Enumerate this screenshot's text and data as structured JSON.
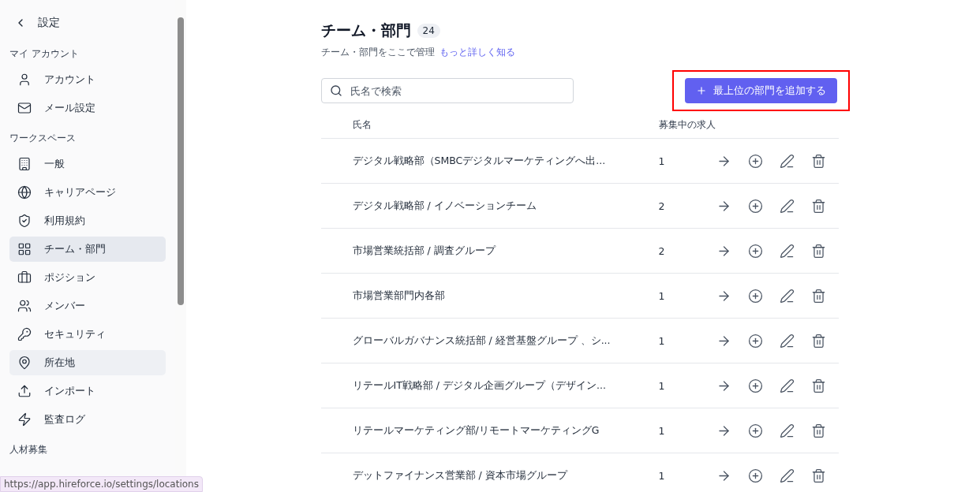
{
  "sidebar": {
    "back_label": "設定",
    "sections": [
      {
        "title": "マイ アカウント",
        "items": [
          {
            "label": "アカウント",
            "selected": false,
            "hovered": false
          },
          {
            "label": "メール設定",
            "selected": false,
            "hovered": false
          }
        ]
      },
      {
        "title": "ワークスペース",
        "items": [
          {
            "label": "一般",
            "selected": false,
            "hovered": false
          },
          {
            "label": "キャリアページ",
            "selected": false,
            "hovered": false
          },
          {
            "label": "利用規約",
            "selected": false,
            "hovered": false
          },
          {
            "label": "チーム・部門",
            "selected": true,
            "hovered": false
          },
          {
            "label": "ポジション",
            "selected": false,
            "hovered": false
          },
          {
            "label": "メンバー",
            "selected": false,
            "hovered": false
          },
          {
            "label": "セキュリティ",
            "selected": false,
            "hovered": false
          },
          {
            "label": "所在地",
            "selected": false,
            "hovered": true
          },
          {
            "label": "インポート",
            "selected": false,
            "hovered": false
          },
          {
            "label": "監査ログ",
            "selected": false,
            "hovered": false
          }
        ]
      },
      {
        "title": "人材募集"
      }
    ]
  },
  "header": {
    "title": "チーム・部門",
    "count": "24",
    "subtitle": "チーム・部門をここで管理",
    "link": "もっと詳しく知る"
  },
  "search": {
    "placeholder": "氏名で検索"
  },
  "add_button": {
    "label": "最上位の部門を追加する",
    "highlighted": true
  },
  "table": {
    "columns": [
      "氏名",
      "募集中の求人"
    ],
    "rows": [
      {
        "name": "デジタル戦略部（SMBCデジタルマーケティングへ出...",
        "jobs": "1"
      },
      {
        "name": "デジタル戦略部 / イノベーションチーム",
        "jobs": "2"
      },
      {
        "name": "市場営業統括部 / 調査グループ",
        "jobs": "2"
      },
      {
        "name": "市場営業部門内各部",
        "jobs": "1"
      },
      {
        "name": "グローバルガバナンス統括部 / 経営基盤グループ 、シ...",
        "jobs": "1"
      },
      {
        "name": "リテールIT戦略部 / デジタル企画グループ（デザイン...",
        "jobs": "1"
      },
      {
        "name": "リテールマーケティング部/リモートマーケティングG",
        "jobs": "1"
      },
      {
        "name": "デットファイナンス営業部 / 資本市場グループ",
        "jobs": "1"
      }
    ]
  },
  "status_url": "https://app.hireforce.io/settings/locations"
}
